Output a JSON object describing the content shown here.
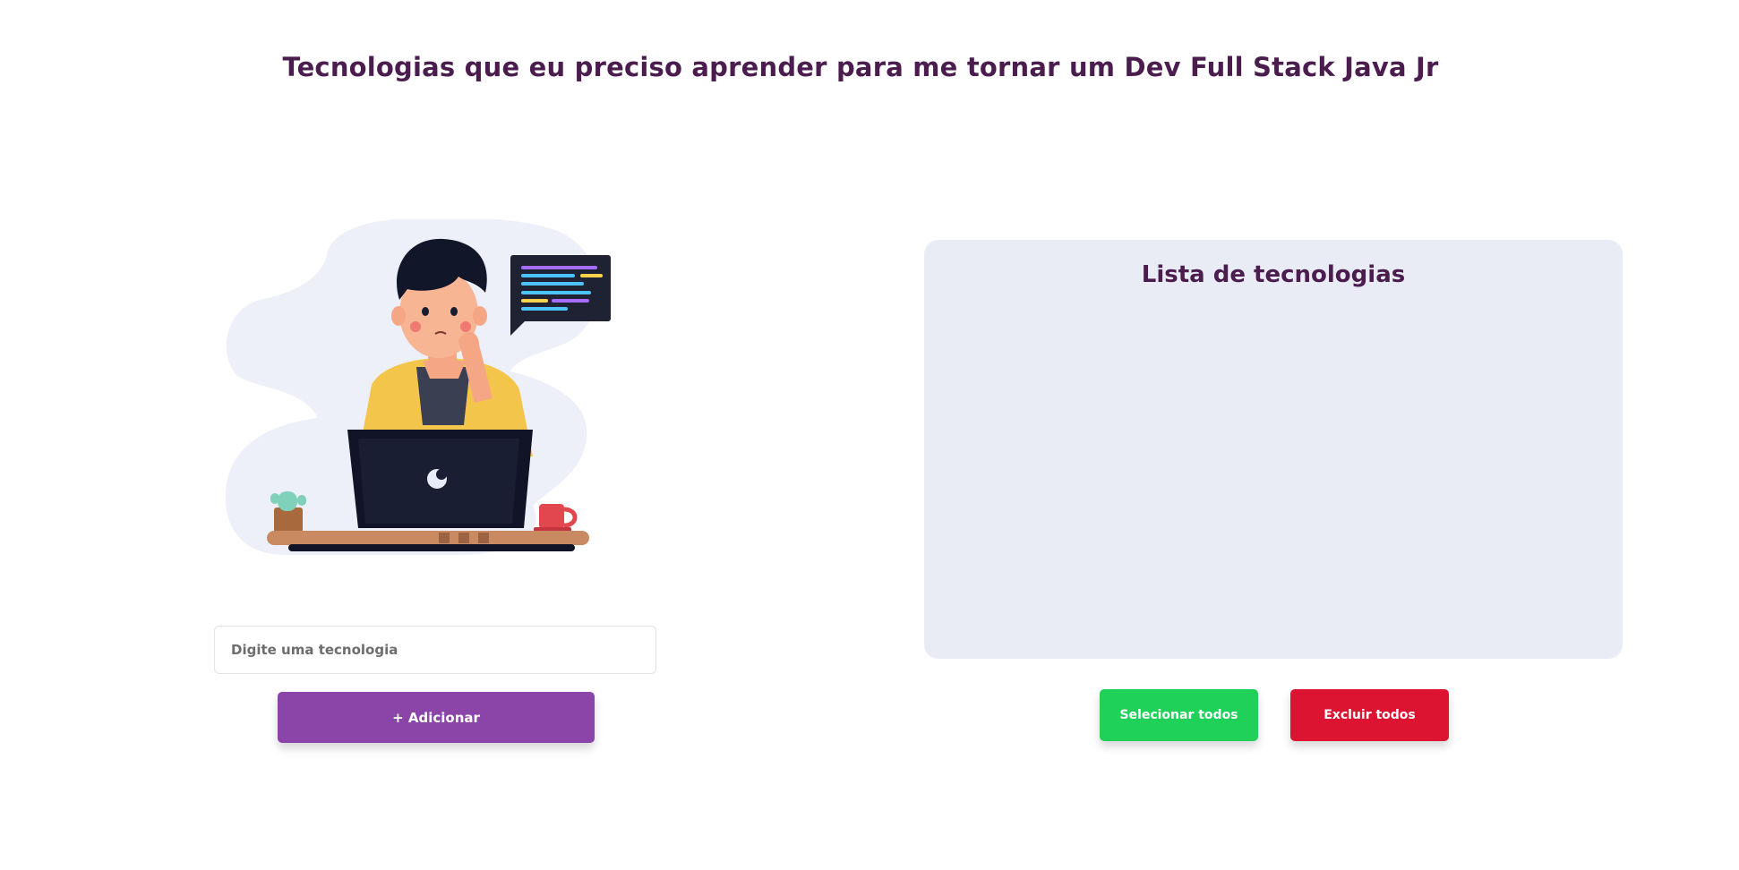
{
  "header": {
    "title": "Tecnologias que eu preciso aprender para me tornar um Dev Full Stack Java Jr"
  },
  "form": {
    "input_placeholder": "Digite uma tecnologia",
    "input_value": "",
    "add_label": "+ Adicionar"
  },
  "list": {
    "title": "Lista de tecnologias",
    "items": []
  },
  "actions": {
    "select_all_label": "Selecionar todos",
    "delete_all_label": "Excluir todos"
  },
  "colors": {
    "title": "#4b1d4f",
    "add_button": "#8b44a8",
    "select_button": "#1fd159",
    "delete_button": "#dc1432",
    "panel": "#e9ecf5"
  }
}
